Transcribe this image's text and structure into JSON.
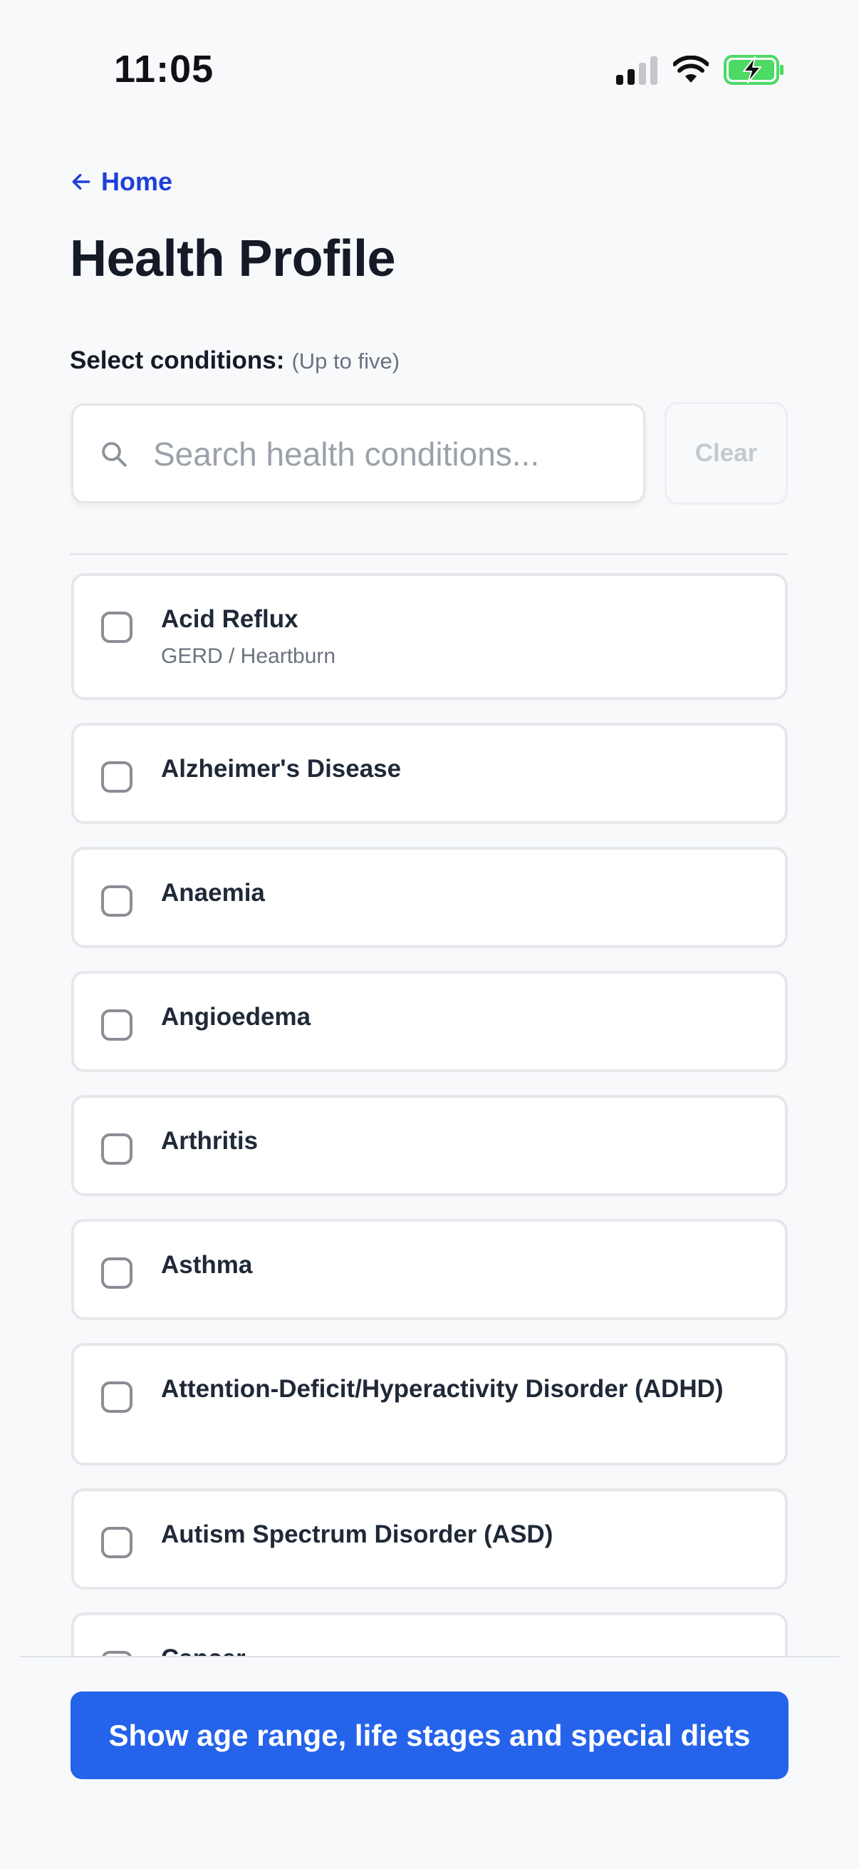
{
  "status_bar": {
    "time": "11:05",
    "icons": [
      "cellular-signal-icon",
      "wifi-icon",
      "battery-charging-icon"
    ],
    "battery_color": "#4cd964"
  },
  "nav": {
    "back_label": "Home",
    "back_icon": "arrow-left-icon"
  },
  "page": {
    "title": "Health Profile"
  },
  "selector": {
    "label": "Select conditions:",
    "hint": "(Up to five)",
    "search_placeholder": "Search health conditions...",
    "search_value": "",
    "clear_label": "Clear"
  },
  "conditions": [
    {
      "name": "Acid Reflux",
      "subtitle": "GERD / Heartburn",
      "checked": false
    },
    {
      "name": "Alzheimer's Disease",
      "checked": false
    },
    {
      "name": "Anaemia",
      "checked": false
    },
    {
      "name": "Angioedema",
      "checked": false
    },
    {
      "name": "Arthritis",
      "checked": false
    },
    {
      "name": "Asthma",
      "checked": false
    },
    {
      "name": "Attention-Deficit/Hyperactivity Disorder (ADHD)",
      "checked": false
    },
    {
      "name": "Autism Spectrum Disorder (ASD)",
      "checked": false
    },
    {
      "name": "Cancer",
      "checked": false
    }
  ],
  "footer": {
    "button_label": "Show age range, life stages and special diets"
  },
  "colors": {
    "accent": "#2563eb",
    "link": "#1e40d8",
    "background": "#f8f9fb"
  }
}
